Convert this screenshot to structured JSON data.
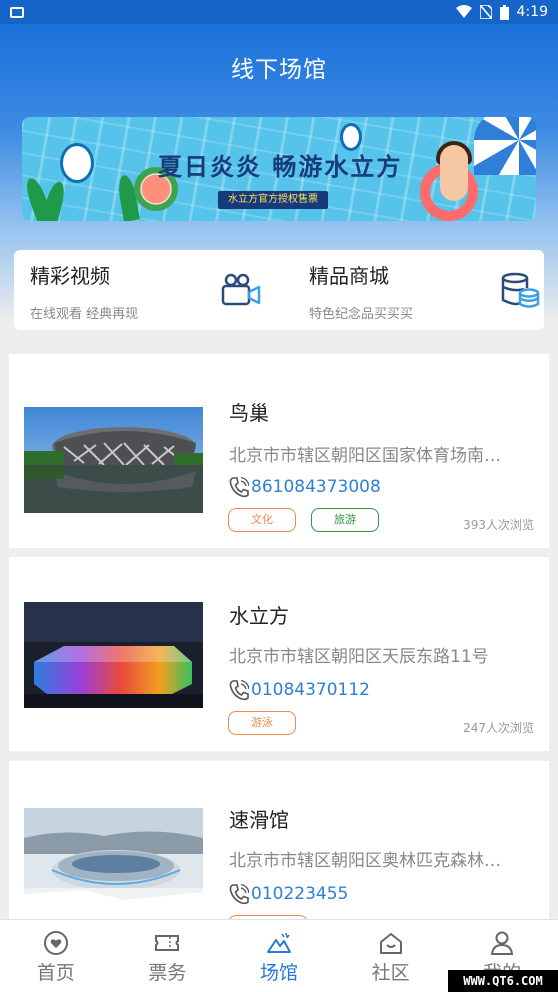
{
  "status_bar": {
    "time": "4:19"
  },
  "header": {
    "title": "线下场馆"
  },
  "banner": {
    "headline": "夏日炎炎 畅游水立方",
    "subline": "水立方官方授权售票"
  },
  "quick_links": [
    {
      "title": "精彩视频",
      "subtitle": "在线观看 经典再现",
      "icon": "video-camera-icon"
    },
    {
      "title": "精品商城",
      "subtitle": "特色纪念品买买买",
      "icon": "database-icon"
    }
  ],
  "venues": [
    {
      "name": "鸟巢",
      "address": "北京市市辖区朝阳区国家体育场南…",
      "phone": "861084373008",
      "tags": [
        "文化",
        "旅游"
      ],
      "views": "393人次浏览"
    },
    {
      "name": "水立方",
      "address": "北京市市辖区朝阳区天辰东路11号",
      "phone": "01084370112",
      "tags": [
        "游泳"
      ],
      "views": "247人次浏览"
    },
    {
      "name": "速滑馆",
      "address": "北京市市辖区朝阳区奥林匹克森林…",
      "phone": "010223455",
      "tags": [],
      "views": ""
    }
  ],
  "tabbar": [
    {
      "label": "首页",
      "icon": "heart-icon"
    },
    {
      "label": "票务",
      "icon": "ticket-icon"
    },
    {
      "label": "场馆",
      "icon": "venue-icon"
    },
    {
      "label": "社区",
      "icon": "community-icon"
    },
    {
      "label": "我的",
      "icon": "user-icon"
    }
  ],
  "watermark": "WWW.QT6.COM",
  "colors": {
    "primary": "#1a6fd8",
    "accent": "#2878d6",
    "tag_orange": "#f08a4b",
    "tag_green": "#2f9a3c"
  }
}
